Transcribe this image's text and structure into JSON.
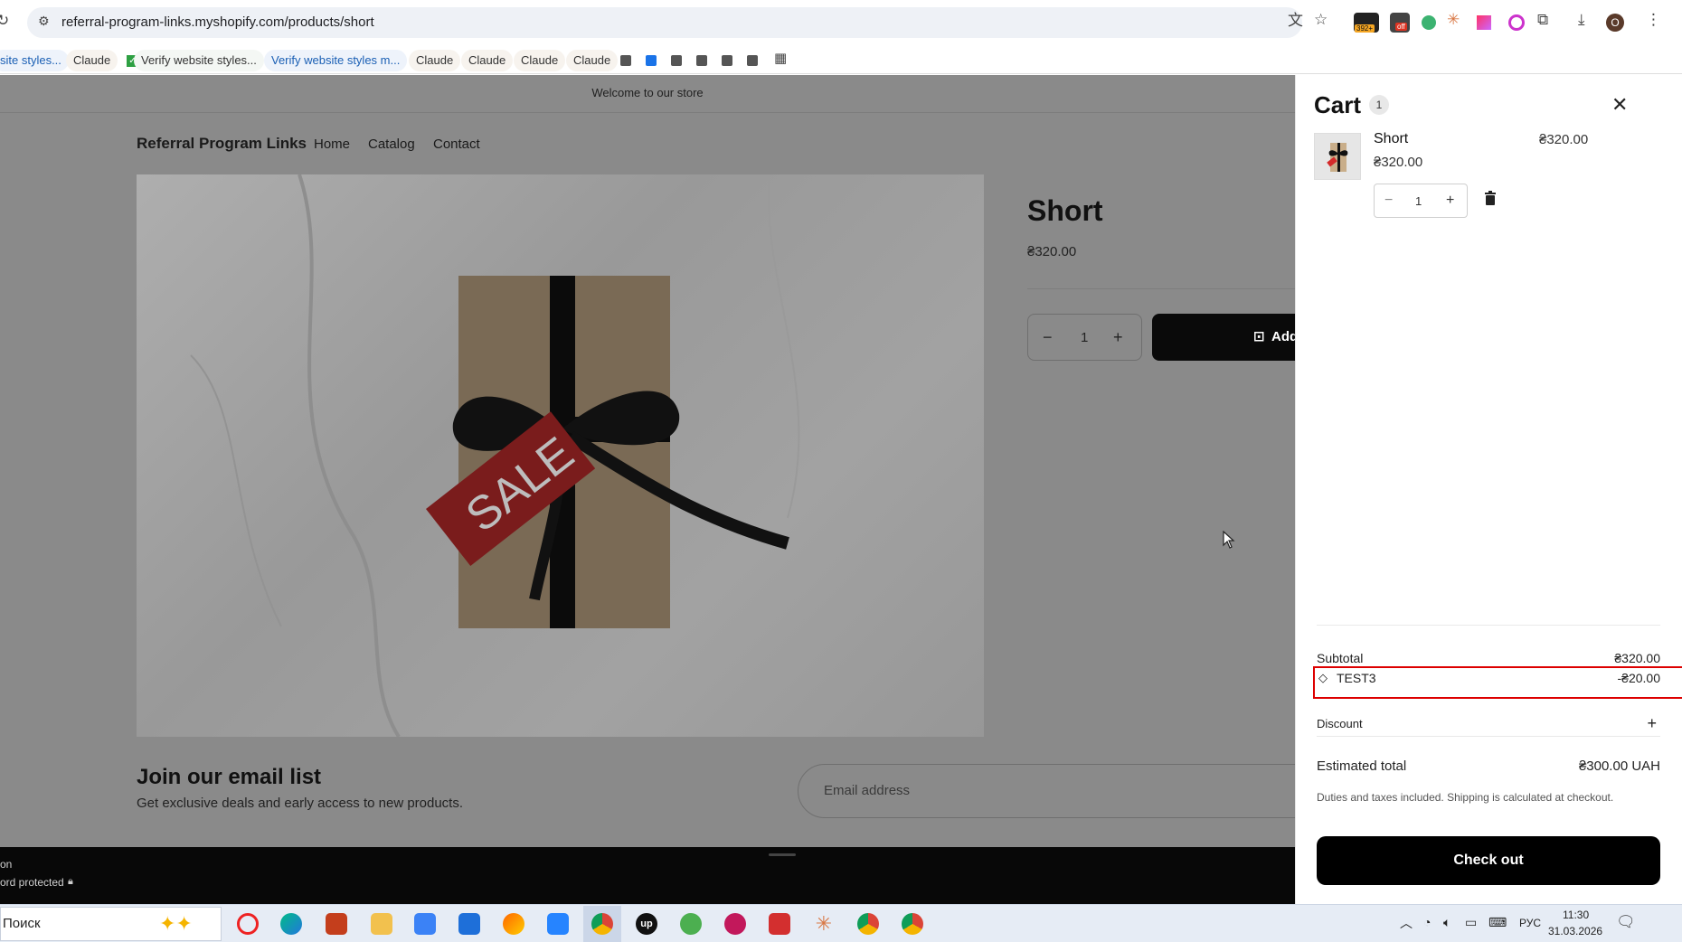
{
  "browser": {
    "url": "referral-program-links.myshopify.com/products/short",
    "bookmarks": [
      "site styles...",
      "Claude",
      "Verify website styles...",
      "Verify website styles m...",
      "Claude",
      "Claude",
      "Claude",
      "Claude"
    ],
    "ext_badge_count": "392+",
    "ext_off_label": "off",
    "profile_initial": "O"
  },
  "store": {
    "announcement": "Welcome to our store",
    "brand": "Referral Program Links",
    "nav": [
      "Home",
      "Catalog",
      "Contact"
    ],
    "product": {
      "title": "Short",
      "price": "₴320.00",
      "quantity": "1",
      "add_label": "Add",
      "image_tag_text": "SALE"
    },
    "newsletter": {
      "heading": "Join our email list",
      "subtext": "Get exclusive deals and early access to new products.",
      "email_placeholder": "Email address"
    },
    "footer": {
      "line1": "on",
      "line2": "ord protected"
    }
  },
  "cart": {
    "title": "Cart",
    "count": "1",
    "item": {
      "name": "Short",
      "unit_price": "₴320.00",
      "line_total": "₴320.00",
      "quantity": "1"
    },
    "subtotal_label": "Subtotal",
    "subtotal_value": "₴320.00",
    "discount_code": "TEST3",
    "discount_value": "-₴20.00",
    "discount_label": "Discount",
    "estimated_label": "Estimated total",
    "estimated_value": "₴300.00 UAH",
    "taxes_note": "Duties and taxes included. Shipping is calculated at checkout.",
    "checkout_label": "Check out"
  },
  "taskbar": {
    "search_placeholder": "Поиск",
    "language": "РУС",
    "time": "11:30",
    "date": "31.03.2026"
  }
}
